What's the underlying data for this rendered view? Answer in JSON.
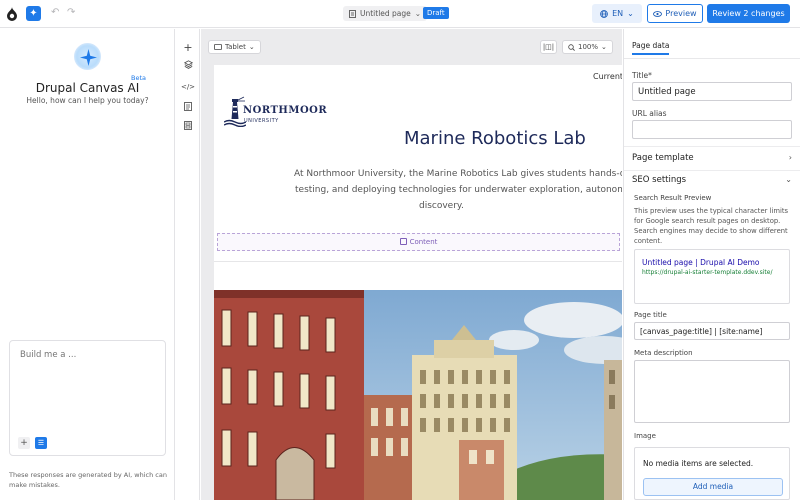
{
  "topbar": {
    "page_name": "Untitled page",
    "status_badge": "Draft",
    "language": "EN",
    "preview_label": "Preview",
    "review_label": "Review 2 changes"
  },
  "ai_panel": {
    "title": "Drupal Canvas AI",
    "beta": "Beta",
    "subtitle": "Hello, how can I help you today?",
    "prompt_placeholder": "Build me a ...",
    "disclaimer": "These responses are generated by AI, which can make mistakes."
  },
  "rail": {
    "icons": [
      "plus-icon",
      "layers-icon",
      "code-icon",
      "file-icon",
      "library-icon"
    ]
  },
  "canvas": {
    "viewport": "Tablet",
    "zoom": "100%",
    "page": {
      "nav_link": "Current",
      "logo_name": "NORTHMOOR",
      "logo_sub": "UNIVERSITY",
      "hero_title": "Marine Robotics Lab",
      "hero_body_lines": [
        "At Northmoor University, the Marine Robotics Lab gives students hands-on exp",
        "testing, and deploying technologies for underwater exploration, autonomous s",
        "discovery."
      ],
      "content_slot": "Content"
    }
  },
  "side_panel": {
    "tab": "Page data",
    "title_label": "Title*",
    "title_value": "Untitled page",
    "alias_label": "URL alias",
    "alias_value": "",
    "page_template_label": "Page template",
    "seo_label": "SEO settings",
    "search_preview_label": "Search Result Preview",
    "search_preview_help": "This preview uses the typical character limits for Google search result pages on desktop. Search engines may decide to show different content.",
    "serp_title": "Untitled page | Drupal AI Demo",
    "serp_url": "https://drupal-ai-starter-template.ddev.site/",
    "page_title_label": "Page title",
    "page_title_value": "[canvas_page:title] | [site:name]",
    "meta_description_label": "Meta description",
    "image_label": "Image",
    "no_media": "No media items are selected.",
    "add_media": "Add media"
  },
  "colors": {
    "accent": "#1f7ae8",
    "brand_navy": "#1e2a5a",
    "slot_purple": "#7e5fb8"
  }
}
